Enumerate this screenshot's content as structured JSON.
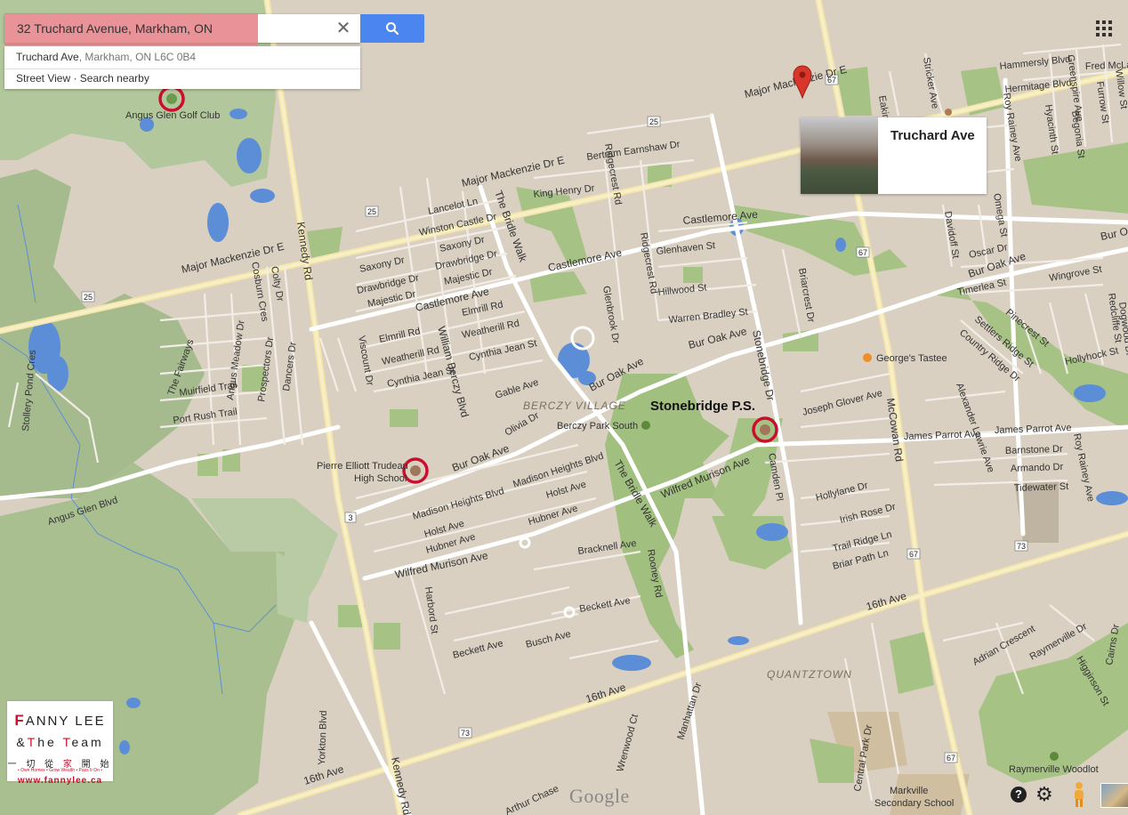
{
  "search": {
    "query": "32 Truchard Avenue, Markham, ON",
    "suggestion_primary": "Truchard Ave",
    "suggestion_secondary": ", Markham, ON L6C 0B4",
    "suggestion_actions": "Street View · Search nearby"
  },
  "info_card": {
    "title": "Truchard Ave"
  },
  "map": {
    "areas": [
      "BERCZY VILLAGE",
      "QUANTZTOWN"
    ],
    "highlighted_places": [
      "Stonebridge P.S.",
      "Pierre Elliott Trudeau High School",
      "Angus Glen Golf Club"
    ],
    "places": [
      "Berczy Park South",
      "George's Tastee",
      "Raymerville Woodlot",
      "Markville Secondary School"
    ],
    "highway_shields": [
      "25",
      "67",
      "3",
      "73"
    ]
  },
  "labels": {
    "angus_glen": "Angus Glen Golf Club",
    "pierre1": "Pierre Elliott Trudeau",
    "pierre2": "High School",
    "stonebridge": "Stonebridge P.S.",
    "berczy_village": "BERCZY VILLAGE",
    "berczy_park": "Berczy Park South",
    "georges": "George's Tastee",
    "quantztown": "QUANTZTOWN",
    "raymerville": "Raymerville Woodlot",
    "markville1": "Markville",
    "markville2": "Secondary School",
    "major_mackenzie_w": "Major Mackenzie Dr E",
    "major_mackenzie_mid": "Major Mackenzie Dr E",
    "major_mackenzie_e": "Major Mackenzie Dr E",
    "castlemore_w": "Castlemore Ave",
    "castlemore_mid": "Castlemore Ave",
    "castlemore_e": "Castlemore Ave",
    "bur_oak_w": "Bur Oak Ave",
    "bur_oak_mid": "Bur Oak Ave",
    "bur_oak_c": "Bur Oak Ave",
    "bur_oak_e": "Bur Oak Ave",
    "bur_oak_far": "Bur Oa",
    "wilfred_w": "Wilfred Murison Ave",
    "wilfred_e": "Wilfred Murison Ave",
    "sixteenth_w": "16th Ave",
    "sixteenth_mid": "16th Ave",
    "sixteenth_e": "16th Ave",
    "kennedy_n": "Kennedy Rd",
    "kennedy_s": "Kennedy Rd",
    "mccowan": "McCowan Rd",
    "bridle_n": "The Bridle Walk",
    "bridle_s": "The Bridle Walk",
    "william_berczy": "William Berczy Blvd",
    "stonebridge_dr": "Stonebridge Dr",
    "roy_rainey": "Roy Rainey Ave",
    "roy_rainey_s": "Roy Rainey Ave",
    "angus_glen_blvd": "Angus Glen Blvd",
    "the_fairways": "The Fairways",
    "muirfield": "Muirfield Trail",
    "port_rush": "Port Rush Trail",
    "stollery": "Stollery Pond Cres",
    "angus_meadow": "Angus Meadow Dr",
    "prospectors": "Prospectors Dr",
    "dancers": "Dancers Dr",
    "colty": "Colty Dr",
    "cosburn": "Cosburn Cres",
    "lancelot": "Lancelot Ln",
    "winston": "Winston Castle Dr",
    "saxony1": "Saxony Dr",
    "saxony2": "Saxony Dr",
    "drawbridge1": "Drawbridge Dr",
    "drawbridge2": "Drawbridge Dr",
    "majestic1": "Majestic Dr",
    "majestic2": "Majestic Dr",
    "elmrill1": "Elmrill Rd",
    "elmrill2": "Elmrill Rd",
    "weatherill1": "Weatherill Rd",
    "weatherill2": "Weatherill Rd",
    "cynthia1": "Cynthia Jean St",
    "cynthia2": "Cynthia Jean St",
    "viscount": "Viscount Dr",
    "gable": "Gable Ave",
    "olivia": "Olivia Dr",
    "madison1": "Madison Heights Blvd",
    "madison2": "Madison Heights Blvd",
    "holst1": "Holst Ave",
    "holst2": "Holst Ave",
    "hubner1": "Hubner Ave",
    "hubner2": "Hubner Ave",
    "harbord": "Harbord St",
    "beckett1": "Beckett Ave",
    "beckett2": "Beckett Ave",
    "busch": "Busch Ave",
    "bracknell": "Bracknell Ave",
    "rooney": "Rooney Rd",
    "manhattan": "Manhattan Dr",
    "wrenwood": "Wrenwood Ct",
    "yorkton": "Yorkton Blvd",
    "arthur_chase": "Arthur Chase",
    "king_henry": "King Henry Dr",
    "bertram": "Bertram Earnshaw Dr",
    "ridgecrest1": "Ridgecrest Rd",
    "ridgecrest2": "Ridgecrest Rd",
    "glenhaven": "Glenhaven St",
    "hillwood": "Hillwood St",
    "warren": "Warren Bradley St",
    "glenbrook": "Glenbrook Dr",
    "briarcrest": "Briarcrest Dr",
    "joseph_glover": "Joseph Glover Ave",
    "camden": "Camden Pl",
    "hollylane": "Hollylane Dr",
    "irish_rose": "Irish Rose Dr",
    "trail_ridge": "Trail Ridge Ln",
    "briar_path": "Briar Path Ln",
    "central_park": "Central Park Dr",
    "james_parrot1": "James Parrot Ave",
    "james_parrot2": "James Parrot Ave",
    "barnstone": "Barnstone Dr",
    "armando": "Armando Dr",
    "tidewater": "Tidewater St",
    "alexander": "Alexander Lawrie Ave",
    "country_ridge": "Country Ridge Dr",
    "settlers": "Settlers Ridge St",
    "pinecrest": "Pinecrest St",
    "hollyhock": "Hollyhock St",
    "wingrove": "Wingrove St",
    "timerlea": "Timerlea St",
    "oscar": "Oscar Dr",
    "davidoff": "Davidoff St",
    "omega": "Omega St",
    "eakin": "Eakin Dr",
    "stricker": "Stricker Ave",
    "greenspire": "Greenspire Ave",
    "hammersly": "Hammersly Blvd",
    "hermitage": "Hermitage Blvd",
    "hyacinth": "Hyacinth St",
    "begonia": "Begonia St",
    "fred_mclaren": "Fred McLaren",
    "furrow": "Furrow St",
    "willow": "Willow St",
    "raymerville_dr": "Raymerville Dr",
    "adrian": "Adrian Crescent",
    "higginson": "Higginson St",
    "cairns": "Cairns Dr",
    "redcliffe": "Redcliffe St",
    "dogwood": "Dogwood Dr"
  },
  "logo": {
    "name_first": "F",
    "name_rest": "ANNY LEE",
    "team_amp": "&",
    "team_t1": "T",
    "team_he": "he",
    "team_t2": "T",
    "team_eam": "eam",
    "cjk_a": "一 切 從 ",
    "cjk_b": "家",
    "cjk_c": " 開 始",
    "tagline": "• Own Homes • Grow Wealth • Pass It On •",
    "url": "www.fannylee.ca"
  },
  "footer": {
    "google": "Google",
    "help": "?"
  },
  "colors": {
    "land": "#d9d0c2",
    "road": "#ffffff",
    "park": "#8fb76b",
    "water": "#5b8ed7",
    "highlight_circle": "#c8102e",
    "search_button": "#4a85f0"
  }
}
